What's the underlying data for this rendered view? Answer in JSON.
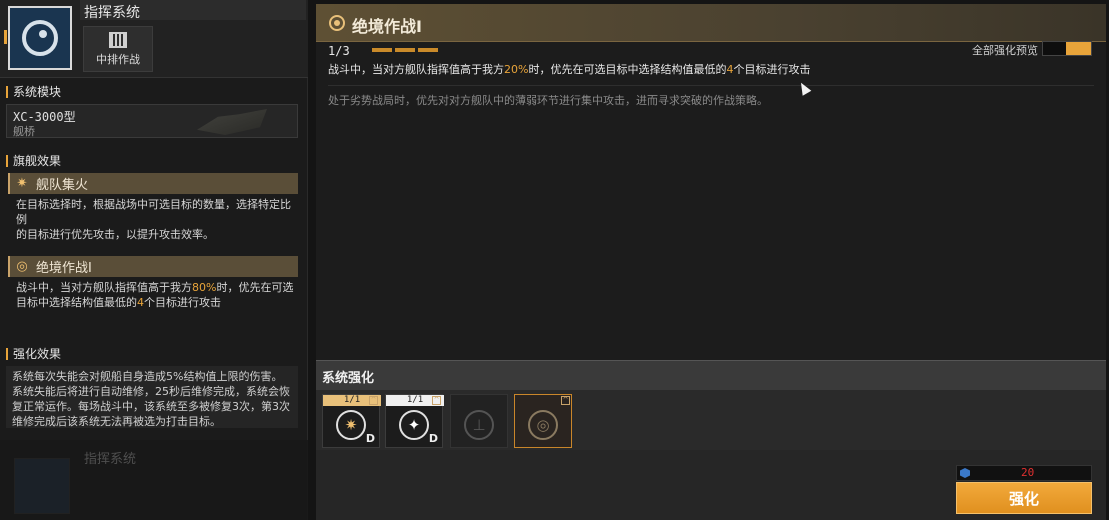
{
  "left": {
    "system_title": "指挥系统",
    "mode_label": "中排作战",
    "module_section": "系统模块",
    "module_name": "XC-3000型",
    "module_sub": "舰桥",
    "flagship_section": "旗舰效果",
    "effects": [
      {
        "title": "舰队集火",
        "desc_line1": "在目标选择时，根据战场中可选目标的数量，选择特定比例",
        "desc_line2": "的目标进行优先攻击，以提升攻击效率。"
      },
      {
        "title": "绝境作战I",
        "desc_a": "战斗中，当对方舰队指挥值高于我方",
        "desc_pct": "80%",
        "desc_b": "时，优先在可选",
        "desc_c": "目标中选择结构值最低的",
        "desc_n": "4",
        "desc_d": "个目标进行攻击"
      }
    ],
    "enhance_section": "强化效果",
    "enhance_text": "系统每次失能会对舰船自身造成5%结构值上限的伤害。系统失能后将进行自动维修，25秒后维修完成，系统会恢复正常运作。每场战斗中，该系统至多被修复3次，第3次维修完成后该系统无法再被选为打击目标。",
    "ghost_title": "指挥系统"
  },
  "main": {
    "title": "绝境作战I",
    "level": "1/3",
    "preview_label": "全部强化预览",
    "desc_a": "战斗中，当对方舰队指挥值高于我方",
    "desc_pct": "20%",
    "desc_b": "时，优先在可选目标中选择结构值最低的",
    "desc_n": "4",
    "desc_c": "个目标进行攻击",
    "lore": "处于劣势战局时，优先对对方舰队中的薄弱环节进行集中攻击，进而寻求突破的作战策略。",
    "enhance_header": "系统强化",
    "slots": [
      {
        "count": "1/1",
        "grade": "D"
      },
      {
        "count": "1/1",
        "grade": "D"
      }
    ],
    "cost_value": "20",
    "enhance_button": "强化"
  },
  "colors": {
    "accent": "#e8a43a",
    "header_gold": "#5e5034",
    "cost_red": "#e03030"
  },
  "icons": [
    "system-icon",
    "mode-icon",
    "flagship-effect-icon",
    "fleet-fire-icon",
    "last-stand-icon",
    "header-target-icon",
    "slot-emblem-icon",
    "lock-icon",
    "currency-icon"
  ]
}
